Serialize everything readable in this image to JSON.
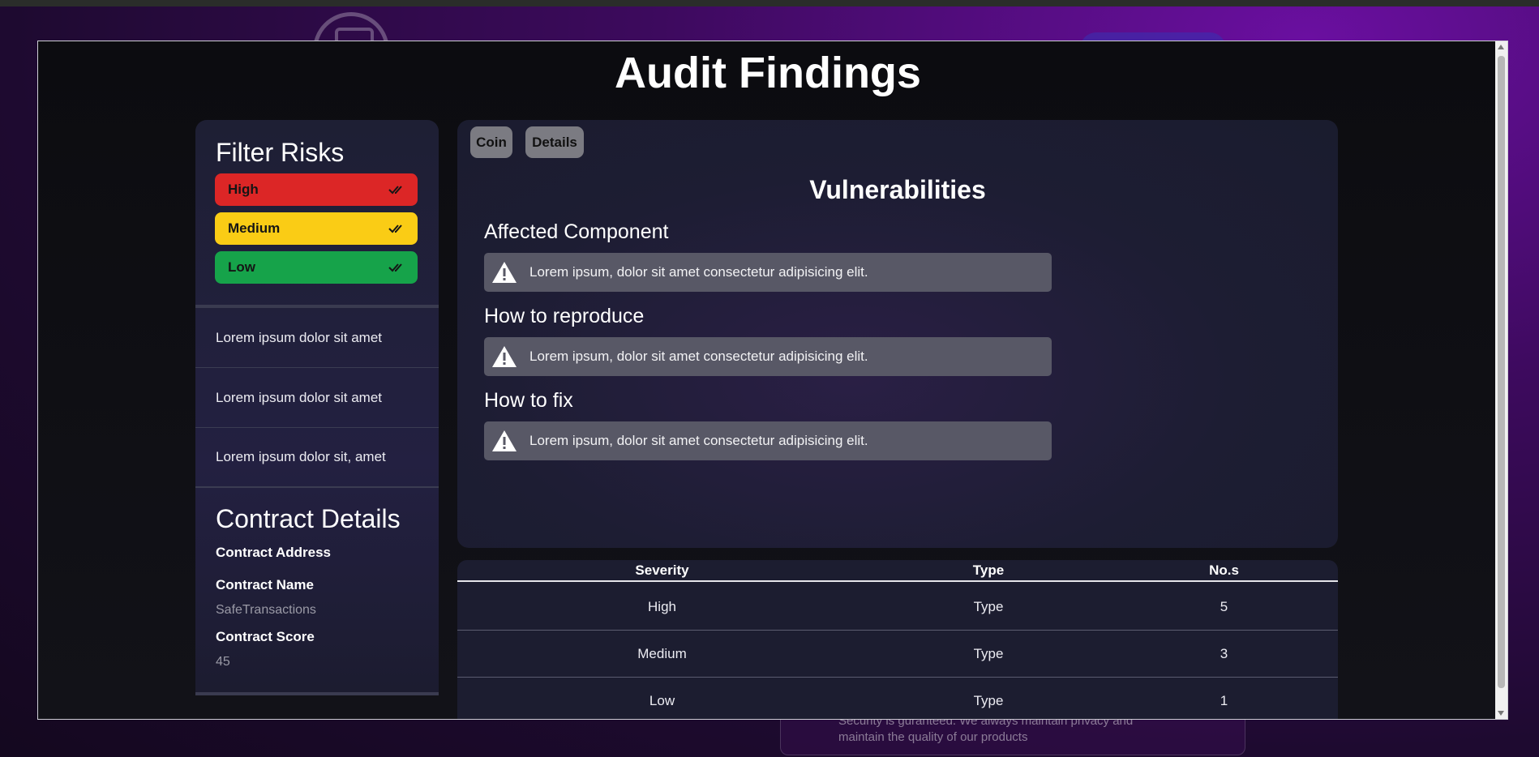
{
  "background": {
    "footer_text": "Security is guranteed. We always maintain privacy and maintain the quality of our products"
  },
  "modal": {
    "title": "Audit Findings"
  },
  "sidebar": {
    "filter_heading": "Filter Risks",
    "filters": [
      {
        "label": "High",
        "color": "#dc2626",
        "icon": "double-check-icon"
      },
      {
        "label": "Medium",
        "color": "#facc15",
        "icon": "double-check-icon"
      },
      {
        "label": "Low",
        "color": "#16a34a",
        "icon": "double-check-icon"
      }
    ],
    "items": [
      {
        "label": "Lorem ipsum dolor sit amet"
      },
      {
        "label": "Lorem ipsum dolor sit amet"
      },
      {
        "label": "Lorem ipsum dolor sit, amet"
      }
    ],
    "contract": {
      "heading": "Contract Details",
      "address_label": "Contract Address",
      "name_label": "Contract Name",
      "name_value": "SafeTransactions",
      "score_label": "Contract Score",
      "score_value": "45"
    }
  },
  "main": {
    "tabs": [
      {
        "label": "Coin"
      },
      {
        "label": "Details"
      }
    ],
    "title": "Vulnerabilities",
    "sections": [
      {
        "heading": "Affected Component",
        "text": "Lorem ipsum, dolor sit amet consectetur adipisicing elit.",
        "icon": "warning-icon"
      },
      {
        "heading": "How to reproduce",
        "text": "Lorem ipsum, dolor sit amet consectetur adipisicing elit.",
        "icon": "warning-icon"
      },
      {
        "heading": "How to fix",
        "text": "Lorem ipsum, dolor sit amet consectetur adipisicing elit.",
        "icon": "warning-icon"
      }
    ]
  },
  "table": {
    "headers": [
      "Severity",
      "Type",
      "No.s"
    ],
    "rows": [
      [
        "High",
        "Type",
        "5"
      ],
      [
        "Medium",
        "Type",
        "3"
      ],
      [
        "Low",
        "Type",
        "1"
      ]
    ]
  }
}
